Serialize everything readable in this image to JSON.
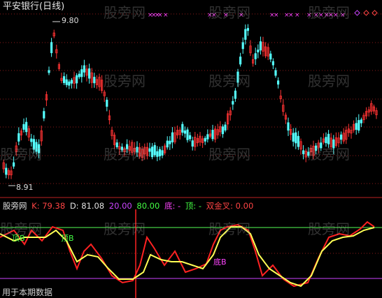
{
  "title": "平安银行(日线)",
  "price_high_label": "9.80",
  "price_low_label": "8.91",
  "watermark": "股旁网",
  "indicator": {
    "source": "股旁网",
    "k_label": "K: 79.38",
    "d_label": "D: 81.08",
    "lo_level": "20.00",
    "hi_level": "80.00",
    "di_label": "底: -",
    "ding_label": "顶: -",
    "shuang_label": "双金叉: 0.00",
    "colors": {
      "k": "#ff4444",
      "d": "#ffff66",
      "lo": "#cc44ff",
      "hi": "#44ff44",
      "di": "#ff44ff",
      "ding": "#44ff44",
      "shuang": "#ff4444",
      "text": "#e0e0e0"
    }
  },
  "markers": {
    "ding_b": "顶B",
    "di_b": "底B"
  },
  "footer": "用于本期数据",
  "colors": {
    "up": "#ff3333",
    "down": "#55ffff",
    "grid": "#8b1a1a",
    "divider": "#bb2222",
    "k_line": "#ff2222",
    "d_line": "#ffff55",
    "upper_band": "#55ff55",
    "lower_band": "#cc44ff",
    "cross_marker": "#ff44ff"
  }
}
